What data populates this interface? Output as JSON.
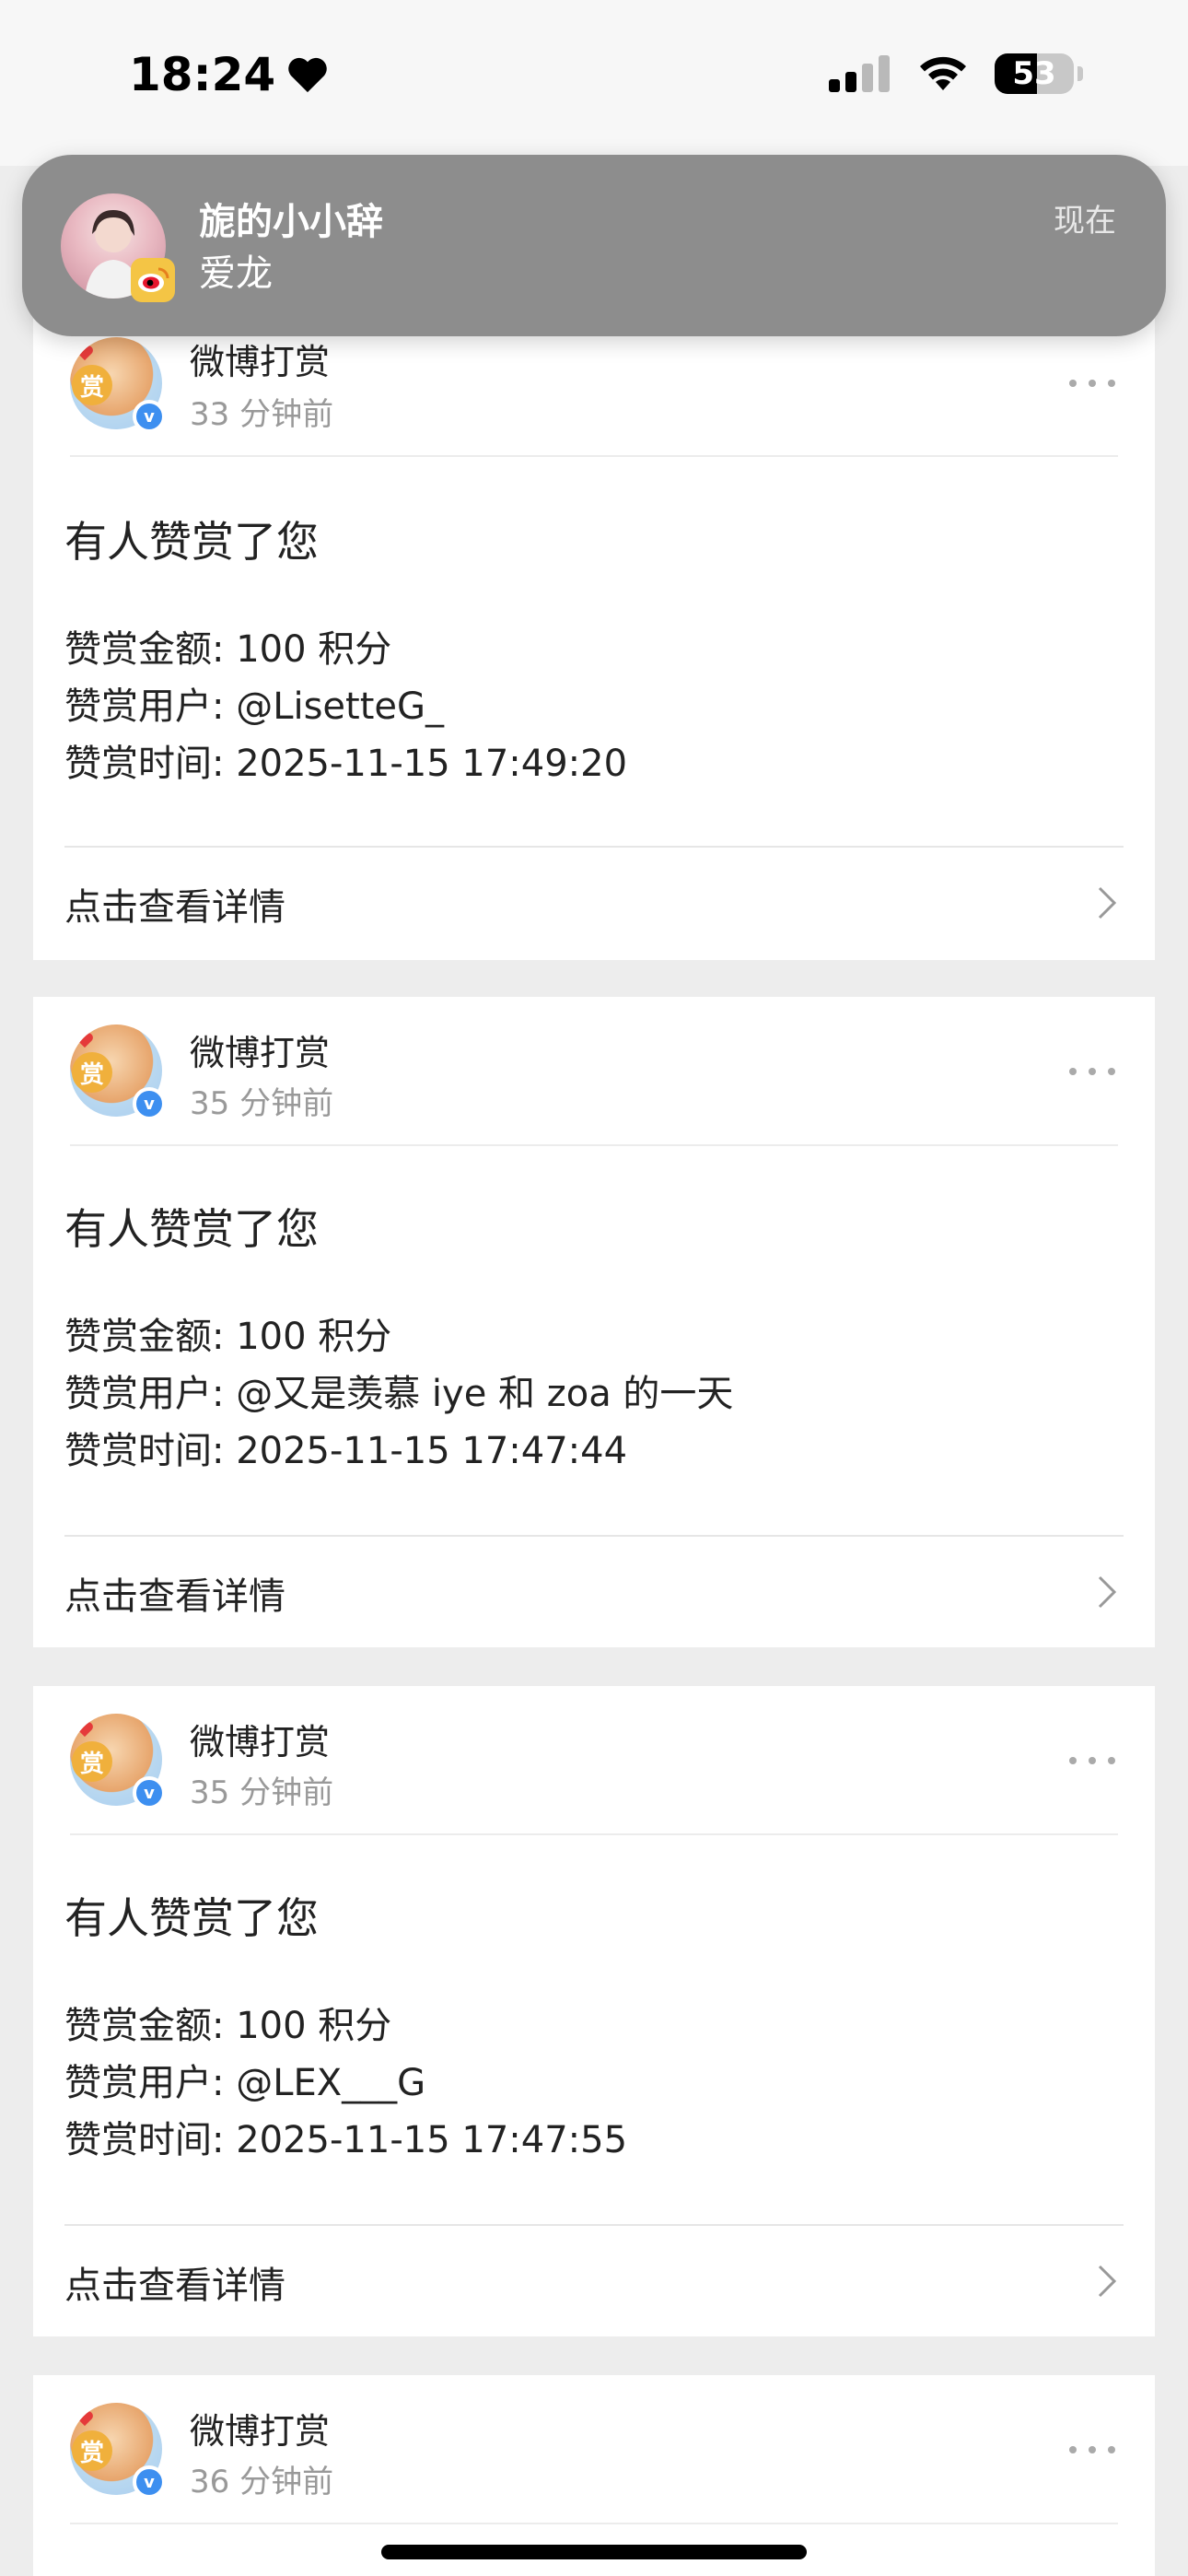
{
  "status_bar": {
    "time": "18:24",
    "battery_level": "53",
    "battery_fraction": 0.53
  },
  "notification": {
    "title": "旎的小小辞",
    "body": "爱龙",
    "time": "现在"
  },
  "cards": [
    {
      "sender": "微博打赏",
      "time_ago": "33 分钟前",
      "title": "有人赞赏了您",
      "amount": "赞赏金额: 100 积分",
      "user": "赞赏用户: @LisetteG_",
      "datetime": "赞赏时间: 2025-11-15 17:49:20",
      "link": "点击查看详情"
    },
    {
      "sender": "微博打赏",
      "time_ago": "35 分钟前",
      "title": "有人赞赏了您",
      "amount": "赞赏金额: 100 积分",
      "user": "赞赏用户: @又是羡慕 iye 和 zoa 的一天",
      "datetime": "赞赏时间: 2025-11-15 17:47:44",
      "link": "点击查看详情"
    },
    {
      "sender": "微博打赏",
      "time_ago": "35 分钟前",
      "title": "有人赞赏了您",
      "amount": "赞赏金额: 100 积分",
      "user": "赞赏用户: @LEX___G",
      "datetime": "赞赏时间: 2025-11-15 17:47:55",
      "link": "点击查看详情"
    },
    {
      "sender": "微博打赏",
      "time_ago": "36 分钟前"
    }
  ],
  "avatar_char": "赏",
  "colors": {
    "background": "#ededed",
    "card": "#ffffff",
    "verified": "#3d8ff0",
    "notification": "#8d8d8d"
  }
}
